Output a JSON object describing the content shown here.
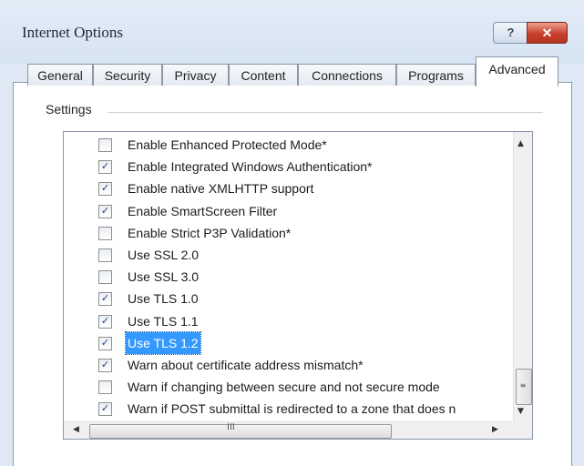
{
  "window": {
    "title": "Internet Options",
    "help_label": "?",
    "close_label": "✕"
  },
  "tabs": [
    {
      "label": "General",
      "active": false
    },
    {
      "label": "Security",
      "active": false
    },
    {
      "label": "Privacy",
      "active": false
    },
    {
      "label": "Content",
      "active": false
    },
    {
      "label": "Connections",
      "active": false
    },
    {
      "label": "Programs",
      "active": false
    },
    {
      "label": "Advanced",
      "active": true
    }
  ],
  "settings": {
    "group_label": "Settings",
    "items": [
      {
        "label": "Enable Enhanced Protected Mode*",
        "checked": false,
        "selected": false
      },
      {
        "label": "Enable Integrated Windows Authentication*",
        "checked": true,
        "selected": false
      },
      {
        "label": "Enable native XMLHTTP support",
        "checked": true,
        "selected": false
      },
      {
        "label": "Enable SmartScreen Filter",
        "checked": true,
        "selected": false
      },
      {
        "label": "Enable Strict P3P Validation*",
        "checked": false,
        "selected": false
      },
      {
        "label": "Use SSL 2.0",
        "checked": false,
        "selected": false
      },
      {
        "label": "Use SSL 3.0",
        "checked": false,
        "selected": false
      },
      {
        "label": "Use TLS 1.0",
        "checked": true,
        "selected": false
      },
      {
        "label": "Use TLS 1.1",
        "checked": true,
        "selected": false
      },
      {
        "label": "Use TLS 1.2",
        "checked": true,
        "selected": true
      },
      {
        "label": "Warn about certificate address mismatch*",
        "checked": true,
        "selected": false
      },
      {
        "label": "Warn if changing between secure and not secure mode",
        "checked": false,
        "selected": false
      },
      {
        "label": "Warn if POST submittal is redirected to a zone that does n",
        "checked": true,
        "selected": false
      }
    ]
  },
  "scrollbars": {
    "vertical_grip": "≡",
    "horizontal_grip": "III"
  }
}
